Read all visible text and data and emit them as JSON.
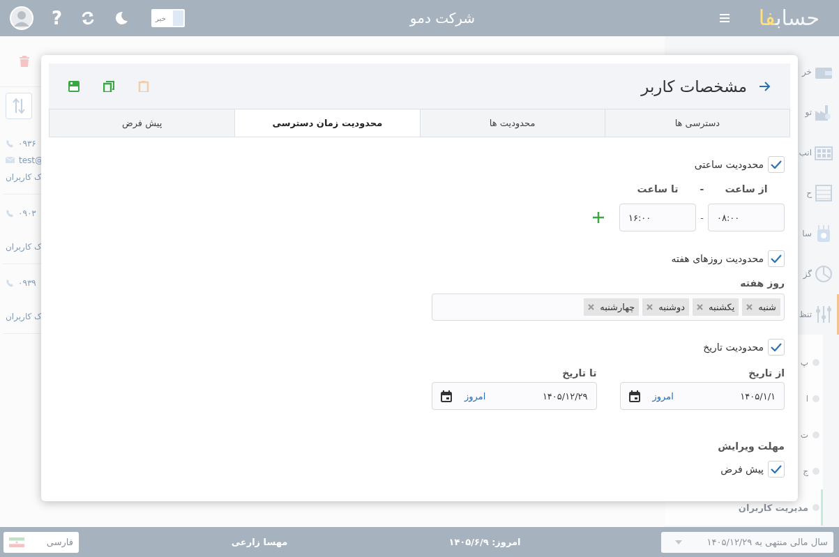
{
  "topbar": {
    "title": "شرکت دمو",
    "help_glyph": "?",
    "toggle": {
      "label": "خیر",
      "on": false
    },
    "logo": {
      "text": "حساب",
      "accent": "فا"
    }
  },
  "sidebar": {
    "items": [
      {
        "label": "خر",
        "selected": false
      },
      {
        "label": "تو",
        "selected": false
      },
      {
        "label": "انب",
        "selected": false
      },
      {
        "label": "ح",
        "selected": false
      },
      {
        "label": "سا",
        "selected": false
      },
      {
        "label": "گز",
        "selected": false
      },
      {
        "label": "تنظ",
        "selected": true,
        "children": [
          {
            "label": "پ",
            "selected": false
          },
          {
            "label": "ا",
            "selected": false
          },
          {
            "label": "ت",
            "selected": false
          },
          {
            "label": "ج",
            "selected": false
          },
          {
            "label": "مدیریت کاربران",
            "selected": true
          }
        ]
      }
    ]
  },
  "user_list": {
    "rows": [
      {
        "phone": "۰۹۳۶",
        "email": "test@",
        "group": "ک کاربران"
      },
      {
        "phone": "۰۹۰۳",
        "group": "ک کاربران"
      },
      {
        "phone": "۰۹۳۹",
        "group": "ک کاربران"
      }
    ]
  },
  "dialog": {
    "title": "مشخصات کاربر",
    "toolbar": [
      {
        "kind": "save",
        "disabled": false
      },
      {
        "kind": "copy",
        "disabled": false
      },
      {
        "kind": "paste",
        "disabled": true
      }
    ],
    "tabs": [
      {
        "label": "دسترسی ها",
        "selected": false
      },
      {
        "label": "محدودیت ها",
        "selected": false
      },
      {
        "label": "محدودیت زمان دسترسی",
        "selected": true
      },
      {
        "label": "پیش فرض",
        "selected": false
      }
    ],
    "hour_limit": {
      "label": "محدودیت ساعتی",
      "checked": true,
      "from_label": "از ساعت",
      "label_separator": "-",
      "to_label": "تا ساعت",
      "from": "۰۸:۰۰",
      "field_separator": "-",
      "to": "۱۶:۰۰"
    },
    "weekday_limit": {
      "label": "محدودیت روزهای هفته",
      "checked": true,
      "field_label": "روز هفته",
      "days": [
        "شنبه",
        "یکشنبه",
        "دوشنبه",
        "چهارشنبه"
      ]
    },
    "date_limit": {
      "label": "محدودیت تاریخ",
      "checked": true,
      "fields": [
        {
          "label": "از تاریخ",
          "value": "۱۴۰۵/۱/۱",
          "today": "امروز"
        },
        {
          "label": "تا تاریخ",
          "value": "۱۴۰۵/۱۲/۲۹",
          "today": "امروز"
        }
      ]
    },
    "edit_deadline": {
      "title": "مهلت ویرایش",
      "label": "پیش فرض",
      "checked": true
    }
  },
  "status_bar": {
    "fiscal_year": "سال مالی منتهی به ۱۴۰۵/۱۲/۲۹",
    "today": "امروز: ۱۴۰۵/۶/۹",
    "user": "مهسا زارعی",
    "language": "فارسی"
  }
}
